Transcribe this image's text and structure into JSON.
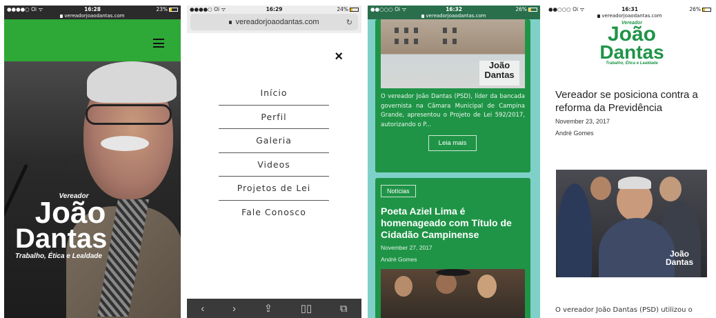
{
  "screen1": {
    "status": {
      "carrier": "●●●●○ Oi ᯤ",
      "time": "16:28",
      "battery": "23%"
    },
    "url": "vereadorjoaodantas.com",
    "logo": {
      "pre": "Vereador",
      "line1": "João",
      "line2": "Dantas",
      "sub": "Trabalho, Ética e Lealdade"
    }
  },
  "screen2": {
    "status": {
      "carrier": "●●●●○ Oi ᯤ",
      "time": "16:29",
      "battery": "24%"
    },
    "url": "vereadorjoaodantas.com",
    "menu": [
      "Início",
      "Perfil",
      "Galeria",
      "Videos",
      "Projetos de Lei",
      "Fale Conosco"
    ]
  },
  "screen3": {
    "status": {
      "carrier": "●●○○○ Oi ᯤ",
      "time": "16:32",
      "battery": "26%"
    },
    "url": "vereadorjoaodantas.com",
    "card1": {
      "img_logo_line1": "João",
      "img_logo_line2": "Dantas",
      "excerpt": "O vereador João Dantas (PSD), líder da bancada governista na Câmara Municipal de Campina Grande, apresentou o Projeto de Lei 592/2017, autorizando o P...",
      "button": "Leia mais"
    },
    "card2": {
      "badge": "Notícias",
      "title": "Poeta Aziel Lima é homenageado com Título de Cidadão Campinense",
      "date": "November 27, 2017",
      "author": "André Gomes"
    }
  },
  "screen4": {
    "status": {
      "carrier": "●●○○○ Oi ᯤ",
      "time": "16:31",
      "battery": "26%"
    },
    "url": "vereadorjoaodantas.com",
    "logo": {
      "pre": "Vereador",
      "line1": "João",
      "line2": "Dantas",
      "sub": "Trabalho, Ética e Lealdade"
    },
    "title": "Vereador se posiciona contra a reforma da Previdência",
    "date": "November 23, 2017",
    "author": "André Gomes",
    "photo_logo_line1": "João",
    "photo_logo_line2": "Dantas",
    "text": "O vereador João Dantas (PSD) utilizou o"
  },
  "colors": {
    "brand_green": "#2ea836",
    "card_green": "#1f9447",
    "teal_bg": "#7fd0c9"
  }
}
